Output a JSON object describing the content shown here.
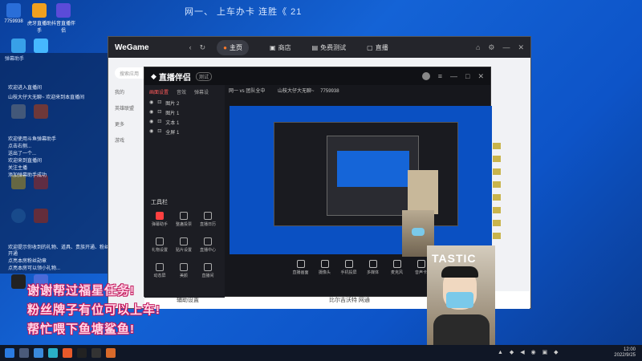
{
  "stream_banner": "网一、  上车办卡 连胜《 21",
  "desktop_top": {
    "qq_label": "7759938",
    "icon2_label": "虎牙直播助手",
    "icon3_label": "抖音直播伴侣"
  },
  "chat": {
    "header": "弹幕助手",
    "lines": [
      "欢迎进入直播间",
      "山枝大仔大无聊~ 欢迎来到本直播间",
      "欢迎使用斗鱼弹幕助手",
      "点击右侧...",
      "送出了一个...",
      "欢迎来到直播间",
      "关注主播",
      "添加弹幕助手成功",
      "欢迎提示你收到的礼物、道具、贵族开通、粉丝开通",
      "点亮本房粉丝勋章",
      "点亮本房可以领小礼物..."
    ]
  },
  "wegame": {
    "logo": "WeGame",
    "tabs": [
      "主页",
      "商店",
      "免费测试",
      "直播"
    ],
    "search_placeholder": "搜索应用",
    "side": [
      "我的",
      "英雄联盟",
      "更多",
      "游戏"
    ],
    "lower_left": "辅助设置",
    "lower_right": "比尔吉沃特 网通"
  },
  "zhibo": {
    "logo": "直播伴侣",
    "version": "测试",
    "left_tabs": [
      "画面设置",
      "音效",
      "弹幕设"
    ],
    "scenes": [
      "图片 2",
      "图片 1",
      "文本 1",
      "全屏 1"
    ],
    "top_info": [
      "网一 vs 团队全中",
      "山枝大仔大无聊~",
      "7759938"
    ],
    "tools_title": "工具栏",
    "tools": [
      "弹幕助手",
      "整蛊投票",
      "直播日历",
      "礼物设置",
      "贴片设置",
      "直播中心",
      "动态屏",
      "美颜",
      "直播间"
    ],
    "bottom_buttons": [
      "直播画面",
      "摄像头",
      "手机投屏",
      "多媒体",
      "麦克风",
      "音声卡"
    ]
  },
  "overlay_text": [
    "谢谢帮过福星任务!",
    "粉丝牌子有位可以上车!",
    "帮忙喂下鱼塘鲨鱼!"
  ],
  "cam_label": "TASTIC",
  "tray": {
    "time": "12:00",
    "date": "2022/9/25"
  },
  "colors": {
    "desktop": "#1463d6",
    "wegame_bar": "#24252b",
    "zb_dark": "#16171c",
    "overlay_pink": "#ffd6e8",
    "overlay_stroke": "#c2185b"
  }
}
